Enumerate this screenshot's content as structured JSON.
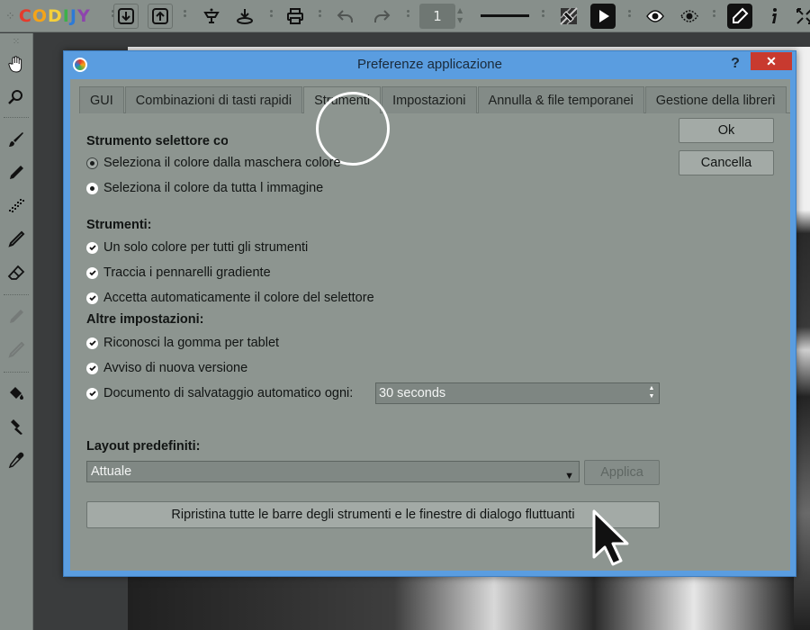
{
  "app": {
    "brand": "CODIJY",
    "brand_colors": [
      "#e53b2c",
      "#f4a419",
      "#f4d03b",
      "#3cb04a",
      "#2d7ad6",
      "#8e44ad"
    ],
    "page_number": "1"
  },
  "toolbar": {
    "icons": [
      "open-icon",
      "save-icon",
      "color-lib-icon",
      "color-recipe-icon",
      "print-icon",
      "undo-icon",
      "redo-icon",
      "brush-size-icon",
      "fill-icon",
      "play-icon",
      "eye-icon",
      "mask-icon",
      "pen-icon",
      "info-icon",
      "fullscreen-icon"
    ]
  },
  "left_toolbar": {
    "icons": [
      "hand-icon",
      "zoom-icon",
      "brush-icon",
      "pencil-icon",
      "spray-icon",
      "thin-pen-icon",
      "eraser-icon",
      "smudge-icon",
      "line-icon",
      "fill-bucket-icon",
      "hammer-icon",
      "eyedropper-icon"
    ]
  },
  "dialog": {
    "title": "Preferenze applicazione",
    "help": "?",
    "close": "✕",
    "tabs": [
      {
        "label": "GUI"
      },
      {
        "label": "Combinazioni di tasti rapidi"
      },
      {
        "label": "Strumenti"
      },
      {
        "label": "Impostazioni"
      },
      {
        "label": "Annulla & file temporanei"
      },
      {
        "label": "Gestione della librerì"
      }
    ],
    "selector_section": {
      "heading": "Strumento selettore colo",
      "option_mask": "Seleziona il colore dalla maschera colore",
      "option_image": "Seleziona il colore da tutta l immagine"
    },
    "tools_section": {
      "heading": "Strumenti:",
      "items": [
        "Un solo colore per tutti gli strumenti",
        "Traccia i pennarelli gradiente",
        "Accetta automaticamente il colore del selettore"
      ]
    },
    "other_section": {
      "heading": "Altre impostazioni:",
      "items": [
        "Riconosci la gomma per tablet",
        "Avviso di nuova versione",
        "Documento di salvataggio automatico ogni:"
      ],
      "autosave_value": "30 seconds"
    },
    "layout_section": {
      "heading": "Layout predefiniti:",
      "selected": "Attuale",
      "apply": "Applica"
    },
    "reset_button": "Ripristina tutte le barre degli strumenti e le finestre di dialogo fluttuanti",
    "ok": "Ok",
    "cancel": "Cancella"
  }
}
